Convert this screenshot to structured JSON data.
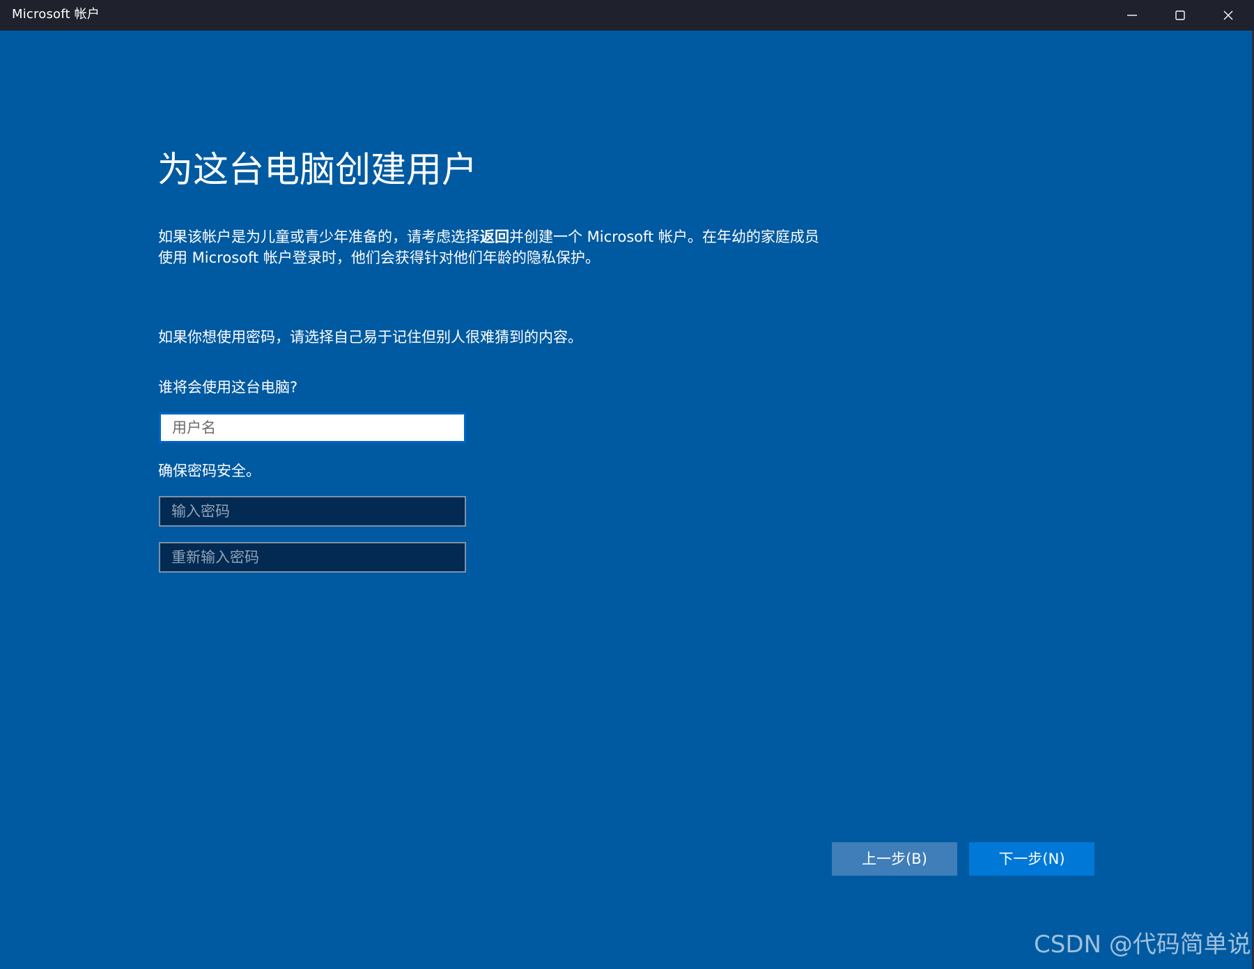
{
  "window": {
    "title": "Microsoft 帐户",
    "controls": {
      "minimize_icon": "minimize-icon",
      "maximize_icon": "maximize-icon",
      "close_icon": "close-icon"
    }
  },
  "main": {
    "title": "为这台电脑创建用户",
    "description1": {
      "before_bold": "如果该帐户是为儿童或青少年准备的，请考虑选择",
      "bold": "返回",
      "after_bold": "并创建一个 Microsoft 帐户。在年幼的家庭成员",
      "line2": "使用 Microsoft 帐户登录时，他们会获得针对他们年龄的隐私保护。"
    },
    "description2": "如果你想使用密码，请选择自己易于记住但别人很难猜到的内容。",
    "username_label": "谁将会使用这台电脑?",
    "username_placeholder": "用户名",
    "username_value": "",
    "password_label": "确保密码安全。",
    "password_placeholder": "输入密码",
    "password_value": "",
    "confirm_password_placeholder": "重新输入密码",
    "confirm_password_value": ""
  },
  "footer": {
    "back_label": "上一步(B)",
    "next_label": "下一步(N)"
  },
  "watermark": "CSDN @代码简单说",
  "colors": {
    "titlebar": "#1f222d",
    "background": "#005aa1",
    "next_button": "#0078d7",
    "back_button": "#3f7eb9",
    "password_field": "#032a52"
  }
}
